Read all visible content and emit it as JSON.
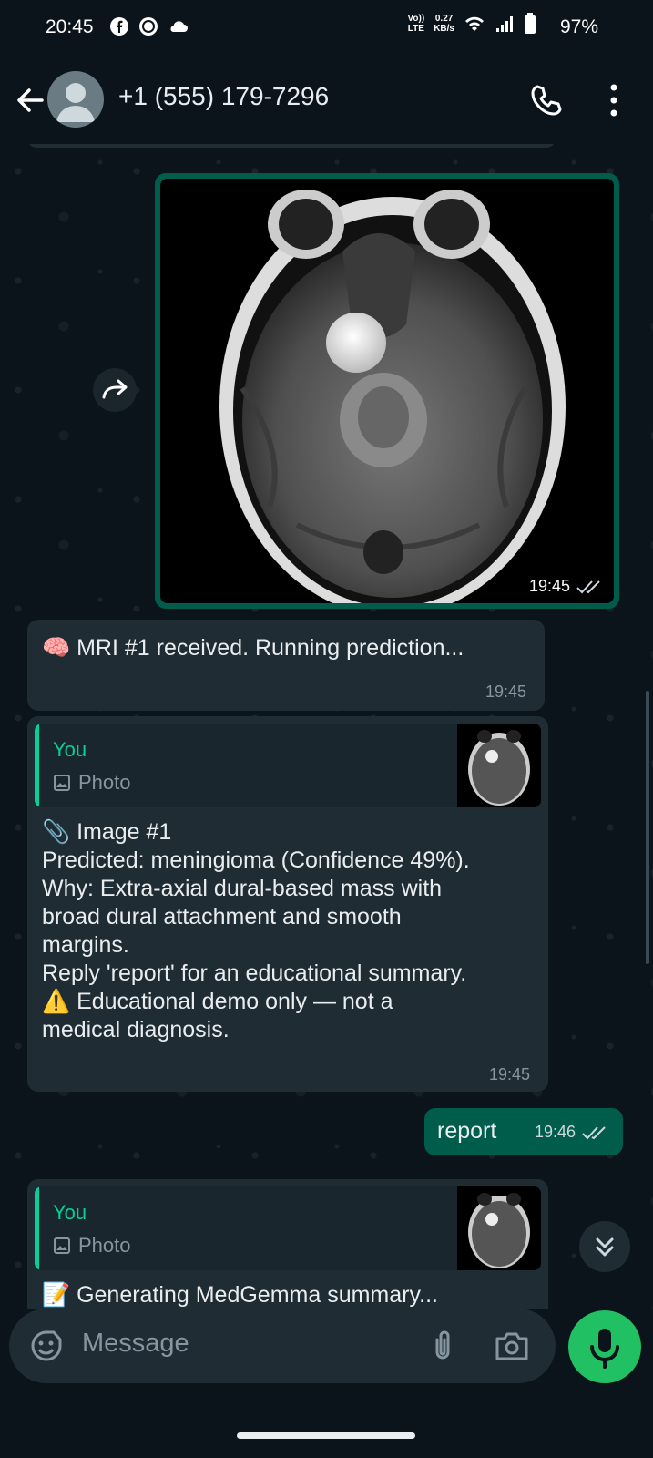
{
  "status_bar": {
    "time": "20:45",
    "net_speed": "0.27",
    "net_unit": "KB/s",
    "net_type_top": "Vo))",
    "net_type_bottom": "LTE",
    "battery": "97%"
  },
  "header": {
    "contact": "+1 (555) 179-7296"
  },
  "messages": {
    "image_time": "19:45",
    "m1_icon": "🧠",
    "m1_text": "MRI #1 received. Running prediction...",
    "m1_time": "19:45",
    "m2_quote_name": "You",
    "m2_quote_type": "Photo",
    "m2_line1": "📎 Image #1",
    "m2_line2": "Predicted: meningioma (Confidence 49%).",
    "m2_line3": "Why: Extra-axial dural-based mass with",
    "m2_line4": "broad dural attachment and smooth",
    "m2_line5": "margins.",
    "m2_line6": "Reply 'report' for an educational summary.",
    "m2_line7": "⚠️ Educational demo only — not a",
    "m2_line8": "medical diagnosis.",
    "m2_time": "19:45",
    "out_text": "report",
    "out_time": "19:46",
    "m3_quote_name": "You",
    "m3_quote_type": "Photo",
    "m3_text": "📝 Generating MedGemma summary..."
  },
  "input": {
    "placeholder": "Message"
  },
  "colors": {
    "background": "#0b141a",
    "incoming_bubble": "#1f2c33",
    "outgoing_bubble": "#005c4b",
    "accent": "#06cf9c",
    "mic_button": "#21c063"
  },
  "icons": {
    "back": "arrow-left-icon",
    "call": "phone-icon",
    "more": "more-vertical-icon",
    "forward": "forward-icon",
    "read": "double-check-icon",
    "photo": "image-icon",
    "scroll": "chevrons-down-icon",
    "emoji": "sticker-icon",
    "attach": "paperclip-icon",
    "camera": "camera-icon",
    "mic": "mic-icon"
  }
}
